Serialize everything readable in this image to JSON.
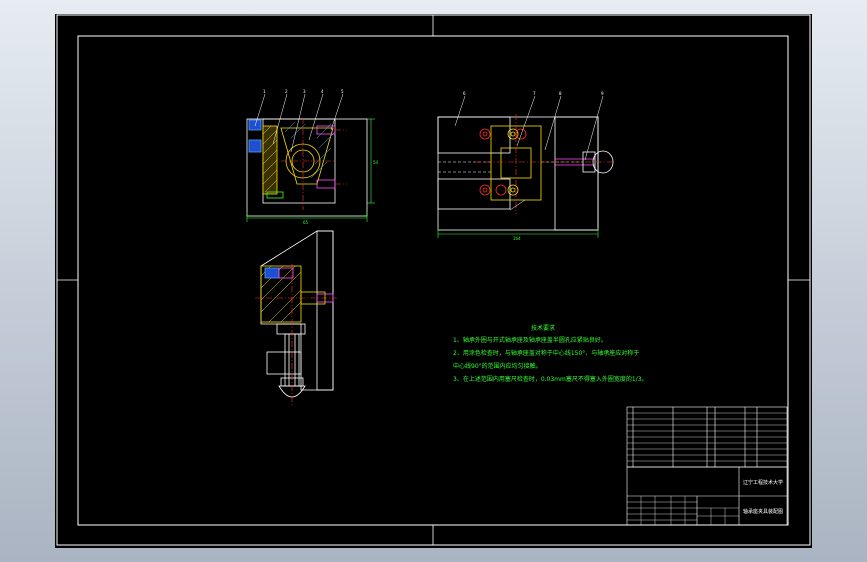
{
  "colors": {
    "background": "#000000",
    "frame": "#ffffff",
    "note_text": "#35ff35",
    "hatch": "#ffe000",
    "section_hatch": "#4aa3ff",
    "center_line": "#ff3030",
    "dimension": "#35ff35"
  },
  "views": {
    "front": {
      "balloons": [
        "1",
        "2",
        "3",
        "4",
        "5"
      ],
      "dim_width": "65",
      "dim_height": "54"
    },
    "top": {
      "balloons": [
        "6",
        "7",
        "8",
        "9"
      ],
      "dim_width": "164"
    },
    "side": {
      "balloons": []
    }
  },
  "notes": {
    "title": "技术要求",
    "lines": [
      "1、轴承外圈与开式轴承座及轴承座盖半圆孔应紧贴良好。",
      "2、用涂色检查时，与轴承座盖对称于中心线150°、与轴承座应对称于",
      "中心线90°的范围内应均匀接触。",
      "3、在上述范围内用塞尺检查时，0.03mm塞尺不得塞入外圈宽度的1/3。"
    ]
  },
  "title_block": {
    "school": "辽宁工程技术大学",
    "drawing_name": "轴承座夹具装配图"
  }
}
